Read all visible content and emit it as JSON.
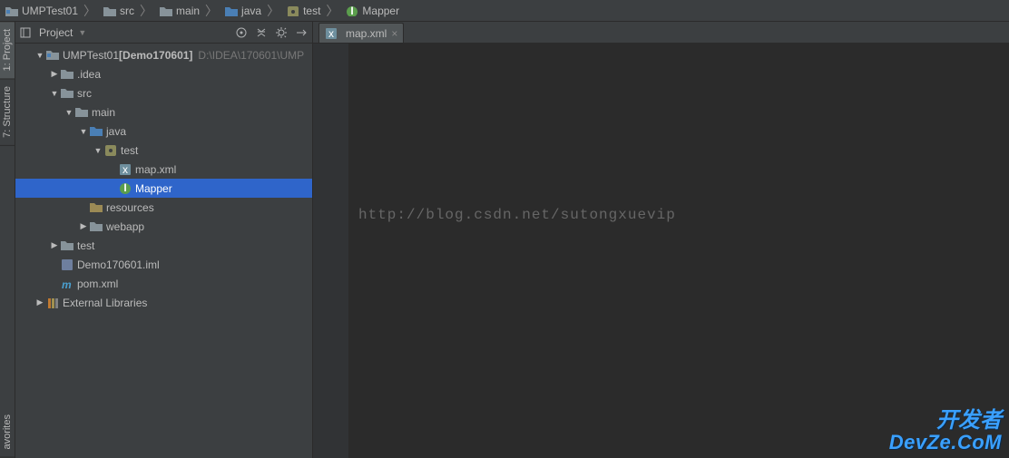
{
  "breadcrumbs": [
    {
      "label": "UMPTest01",
      "icon": "project"
    },
    {
      "label": "src",
      "icon": "folder"
    },
    {
      "label": "main",
      "icon": "folder"
    },
    {
      "label": "java",
      "icon": "folder-src"
    },
    {
      "label": "test",
      "icon": "package"
    },
    {
      "label": "Mapper",
      "icon": "interface"
    }
  ],
  "sidebar": {
    "title": "Project",
    "tools": [
      "target-icon",
      "collapse-icon",
      "gear-icon",
      "hide-icon"
    ]
  },
  "left_tabs": {
    "project": "1: Project",
    "structure": "7: Structure",
    "favorites": "avorites"
  },
  "tree": [
    {
      "depth": 0,
      "arrow": "open",
      "icon": "project",
      "label": "UMPTest01",
      "suffix_bold": "[Demo170601]",
      "suffix_muted": "D:\\IDEA\\170601\\UMP"
    },
    {
      "depth": 1,
      "arrow": "closed",
      "icon": "folder",
      "label": ".idea"
    },
    {
      "depth": 1,
      "arrow": "open",
      "icon": "folder",
      "label": "src"
    },
    {
      "depth": 2,
      "arrow": "open",
      "icon": "folder",
      "label": "main"
    },
    {
      "depth": 3,
      "arrow": "open",
      "icon": "folder-src",
      "label": "java"
    },
    {
      "depth": 4,
      "arrow": "open",
      "icon": "package",
      "label": "test"
    },
    {
      "depth": 5,
      "arrow": "none",
      "icon": "xml",
      "label": "map.xml"
    },
    {
      "depth": 5,
      "arrow": "none",
      "icon": "interface",
      "label": "Mapper",
      "selected": true
    },
    {
      "depth": 3,
      "arrow": "none",
      "icon": "folder-res",
      "label": "resources"
    },
    {
      "depth": 3,
      "arrow": "closed",
      "icon": "folder",
      "label": "webapp"
    },
    {
      "depth": 1,
      "arrow": "closed",
      "icon": "folder",
      "label": "test"
    },
    {
      "depth": 1,
      "arrow": "none",
      "icon": "iml",
      "label": "Demo170601.iml"
    },
    {
      "depth": 1,
      "arrow": "none",
      "icon": "maven",
      "label": "pom.xml"
    },
    {
      "depth": 0,
      "arrow": "closed",
      "icon": "libs",
      "label": "External Libraries"
    }
  ],
  "tab": {
    "label": "map.xml"
  },
  "editor": {
    "line1": "",
    "watermark": "http://blog.csdn.net/sutongxuevip"
  },
  "brand": {
    "cn": "开发者",
    "en": "DevZe.CoM"
  }
}
